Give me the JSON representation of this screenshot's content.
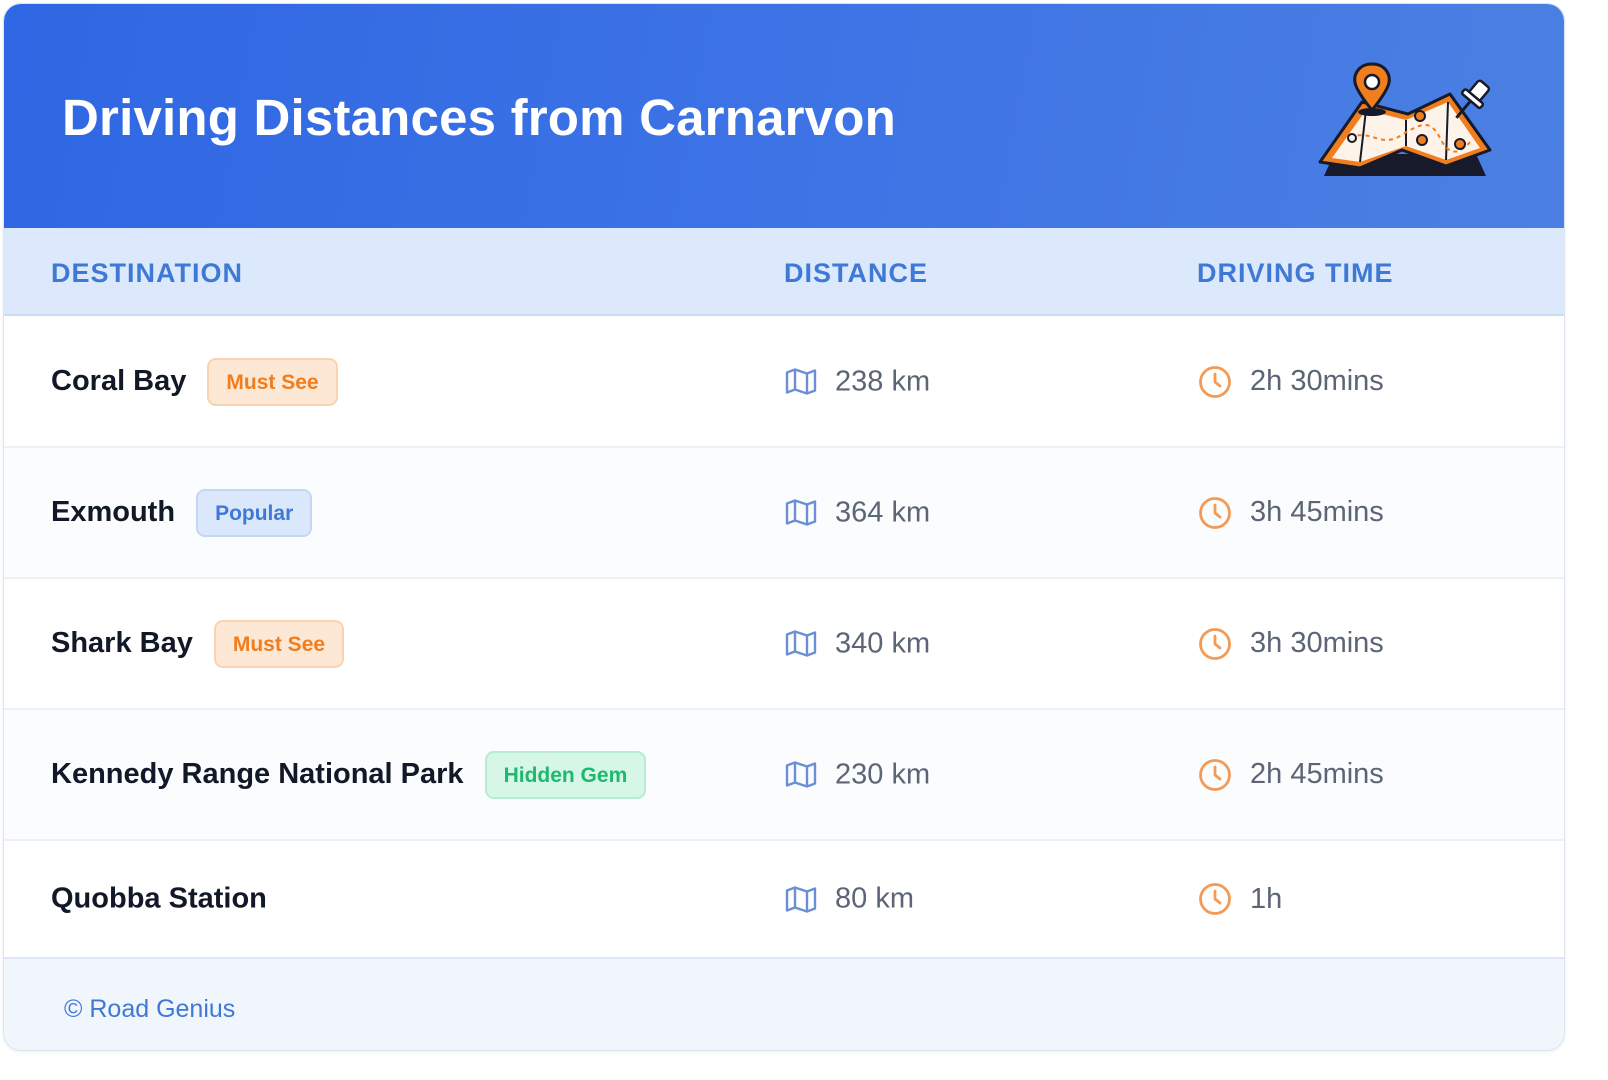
{
  "header": {
    "title": "Driving Distances from Carnarvon",
    "illustration_icon": "map-pin-icon"
  },
  "table": {
    "columns": [
      "DESTINATION",
      "DISTANCE",
      "DRIVING TIME"
    ],
    "rows": [
      {
        "destination": "Coral Bay",
        "badge": "Must See",
        "badge_color": "orange",
        "distance": "238 km",
        "time": "2h 30mins"
      },
      {
        "destination": "Exmouth",
        "badge": "Popular",
        "badge_color": "blue",
        "distance": "364 km",
        "time": "3h 45mins"
      },
      {
        "destination": "Shark Bay",
        "badge": "Must See",
        "badge_color": "orange",
        "distance": "340 km",
        "time": "3h 30mins"
      },
      {
        "destination": "Kennedy Range National Park",
        "badge": "Hidden Gem",
        "badge_color": "green",
        "distance": "230 km",
        "time": "2h 45mins"
      },
      {
        "destination": "Quobba Station",
        "badge": "",
        "badge_color": "",
        "distance": "80 km",
        "time": "1h"
      }
    ],
    "distance_icon": "map-icon",
    "time_icon": "clock-icon"
  },
  "footer": {
    "text": "© Road Genius"
  },
  "colors": {
    "header_gradient_start": "#2f67e4",
    "header_gradient_end": "#4b80e2",
    "accent_blue": "#3f79d6",
    "accent_orange": "#f07d1e",
    "accent_green": "#1fb96d"
  }
}
